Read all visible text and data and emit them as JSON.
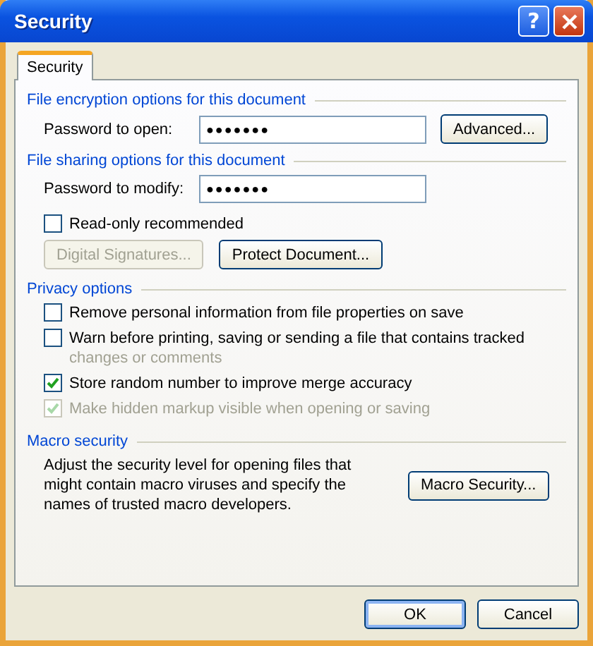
{
  "window": {
    "title": "Security",
    "help": "?"
  },
  "tabs": [
    {
      "label": "Security",
      "selected": true
    }
  ],
  "encryption": {
    "heading": "File encryption options for this document",
    "password": {
      "label": "Password to open:",
      "value": "●●●●●●●"
    },
    "button": {
      "label": "Advanced...",
      "disabled": false
    }
  },
  "sharing": {
    "heading": "File sharing options for this document",
    "password": {
      "label": "Password to modify:",
      "value": "●●●●●●●"
    },
    "checkbox": {
      "label": "Read-only recommended",
      "checked": false,
      "disabled": false
    },
    "buttons": [
      {
        "label": "Digital Signatures...",
        "disabled": true
      },
      {
        "label": "Protect Document...",
        "disabled": false
      }
    ]
  },
  "privacy": {
    "heading": "Privacy options",
    "options": [
      {
        "label": "Remove personal information from file properties on save",
        "checked": false,
        "disabled": false
      },
      {
        "label": "Warn before printing, saving or sending a file that contains tracked",
        "detail": "changes or comments",
        "checked": false,
        "disabled": false
      },
      {
        "label": "Store random number to improve merge accuracy",
        "checked": true,
        "disabled": false
      },
      {
        "label": "Make hidden markup visible when opening or saving",
        "checked": true,
        "disabled": true
      }
    ]
  },
  "macro": {
    "heading": "Macro security",
    "text": "Adjust the security level for opening files that might contain macro viruses and specify the names of trusted macro developers.",
    "button": {
      "label": "Macro Security...",
      "disabled": false
    }
  },
  "buttons": [
    {
      "label": "OK",
      "default": true
    },
    {
      "label": "Cancel",
      "default": false
    }
  ]
}
